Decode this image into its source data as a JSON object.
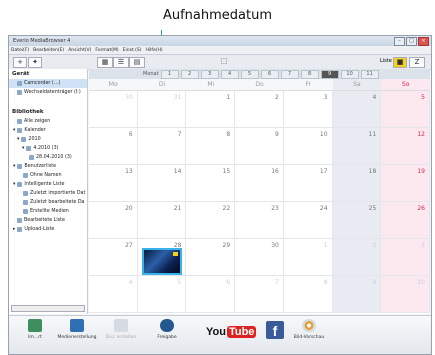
{
  "callout": {
    "label": "Aufnahmedatum"
  },
  "window": {
    "title": "Everio MediaBrowser 4",
    "menu": [
      "Datei(F)",
      "Bearbeiten(E)",
      "Ansicht(V)",
      "Format(M)",
      "Einst.(S)",
      "Hilfe(H)"
    ],
    "controls": {
      "min": "–",
      "max": "□",
      "close": "×"
    }
  },
  "toolbar": {
    "add": "+",
    "tools": "✦",
    "right_label": "Liste"
  },
  "sidebar": {
    "device_header": "Gerät",
    "device_items": [
      "Camcorder (…)",
      "Wechseldatenträger (I:)"
    ],
    "library_header": "Bibliothek",
    "library_items": [
      "Alle zeigen",
      "Kalender",
      "2010",
      "4.2010 (3)",
      "28.04.2010 (3)",
      "Benutzerliste",
      "Ohne Namen",
      "Intelligente Liste",
      "Zuletzt importierte Dat",
      "Zuletzt bearbeitete Da",
      "Erstellte Medien",
      "Bearbeitete Liste",
      "Upload-Liste"
    ]
  },
  "calendar": {
    "month_label": "Monat",
    "months": [
      "1",
      "2",
      "3",
      "4",
      "5",
      "6",
      "7",
      "8",
      "9",
      "10",
      "11",
      "12"
    ],
    "current_month": "4",
    "days": [
      "Mo",
      "Di",
      "Mi",
      "Do",
      "Fr",
      "Sa",
      "So"
    ],
    "weeks": [
      [
        "30",
        "31",
        "1",
        "2",
        "3",
        "4",
        "5"
      ],
      [
        "6",
        "7",
        "8",
        "9",
        "10",
        "11",
        "12"
      ],
      [
        "13",
        "14",
        "15",
        "16",
        "17",
        "18",
        "19"
      ],
      [
        "20",
        "21",
        "22",
        "23",
        "24",
        "25",
        "26"
      ],
      [
        "27",
        "28",
        "29",
        "30",
        "1",
        "2",
        "3"
      ],
      [
        "4",
        "5",
        "6",
        "7",
        "8",
        "9",
        "10"
      ]
    ]
  },
  "bottom": {
    "items": [
      "Im…rt",
      "Medienerstellung",
      "Disc erstellen",
      "Freigabe",
      "YouTube",
      "Facebook",
      "Bild-Vorschau"
    ],
    "youtube_you": "You",
    "youtube_tube": "Tube",
    "facebook": "f"
  }
}
